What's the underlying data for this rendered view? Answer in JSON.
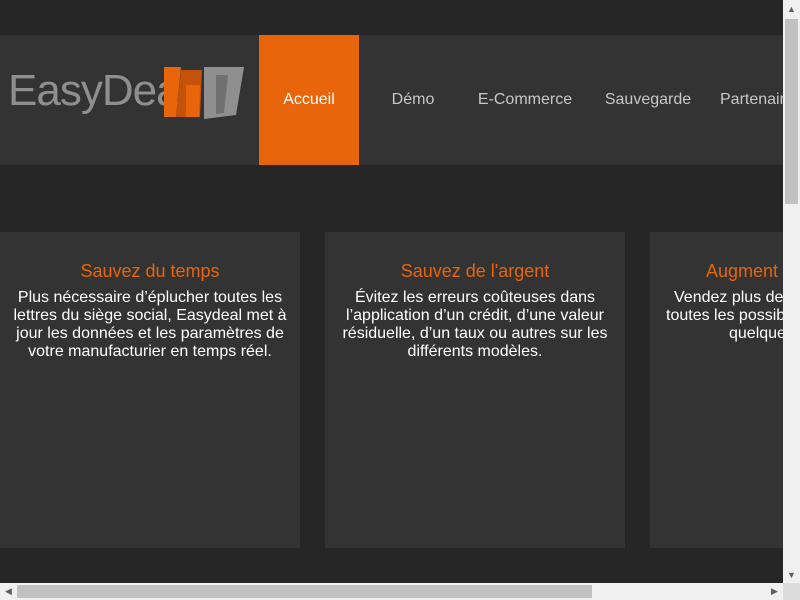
{
  "logo": {
    "text": "EasyDeal",
    "accent_color": "#e8650c",
    "gray_color": "#8f8f8f"
  },
  "nav": {
    "items": [
      {
        "label": "Accueil",
        "active": true
      },
      {
        "label": "Démo"
      },
      {
        "label": "E-Commerce"
      },
      {
        "label": "Sauvegarde"
      },
      {
        "label": "Partenair"
      }
    ]
  },
  "cards": [
    {
      "title": "Sauvez du temps",
      "lines": [
        "Plus nécessaire d’éplucher toutes les",
        "lettres du siège social, Easydeal met à",
        "jour les données et les paramètres de",
        "votre manufacturier en temps réel."
      ]
    },
    {
      "title": "Sauvez de l'argent",
      "lines": [
        "Évitez les erreurs coûteuses dans",
        "l’application d’un crédit, d’une valeur",
        "résiduelle, d’un taux ou autres sur les",
        "différents modèles."
      ]
    },
    {
      "title": "Augment",
      "lines": [
        "Vendez plus de",
        "toutes les possib",
        "quelque"
      ]
    }
  ],
  "scrollbars": {
    "up": "▲",
    "down": "▼",
    "left": "◀",
    "right": "▶"
  },
  "colors": {
    "background": "#262626",
    "panel": "#333333",
    "accent": "#e8650c"
  }
}
